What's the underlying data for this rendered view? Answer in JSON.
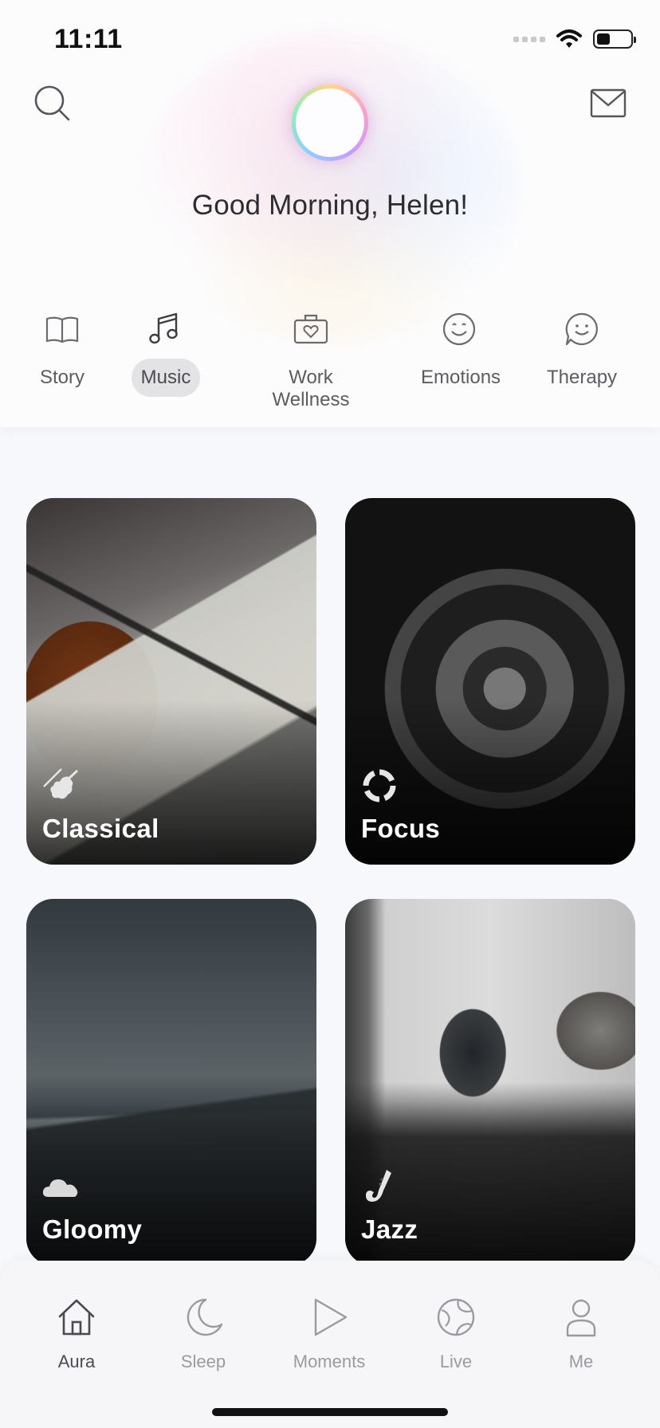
{
  "status_bar": {
    "time": "11:11"
  },
  "header": {
    "greeting": "Good Morning, Helen!"
  },
  "tabs": [
    {
      "label": "Story",
      "icon": "book-icon",
      "active": false
    },
    {
      "label": "Music",
      "icon": "music-note-icon",
      "active": true
    },
    {
      "label": "Work Wellness",
      "icon": "briefcase-heart-icon",
      "active": false
    },
    {
      "label": "Emotions",
      "icon": "smiley-icon",
      "active": false
    },
    {
      "label": "Therapy",
      "icon": "chat-smiley-icon",
      "active": false
    }
  ],
  "cards": [
    {
      "title": "Classical",
      "icon": "violin-icon"
    },
    {
      "title": "Focus",
      "icon": "focus-circle-icon"
    },
    {
      "title": "Gloomy",
      "icon": "cloud-icon"
    },
    {
      "title": "Jazz",
      "icon": "saxophone-icon"
    }
  ],
  "bottom_nav": [
    {
      "label": "Aura",
      "icon": "home-icon",
      "active": true
    },
    {
      "label": "Sleep",
      "icon": "moon-icon",
      "active": false
    },
    {
      "label": "Moments",
      "icon": "play-icon",
      "active": false
    },
    {
      "label": "Live",
      "icon": "globe-icon",
      "active": false
    },
    {
      "label": "Me",
      "icon": "person-icon",
      "active": false
    }
  ],
  "colors": {
    "active_tab_bg": "#e3e3e6",
    "inactive_nav": "#9a9aa0",
    "active_nav": "#4a4a50"
  }
}
